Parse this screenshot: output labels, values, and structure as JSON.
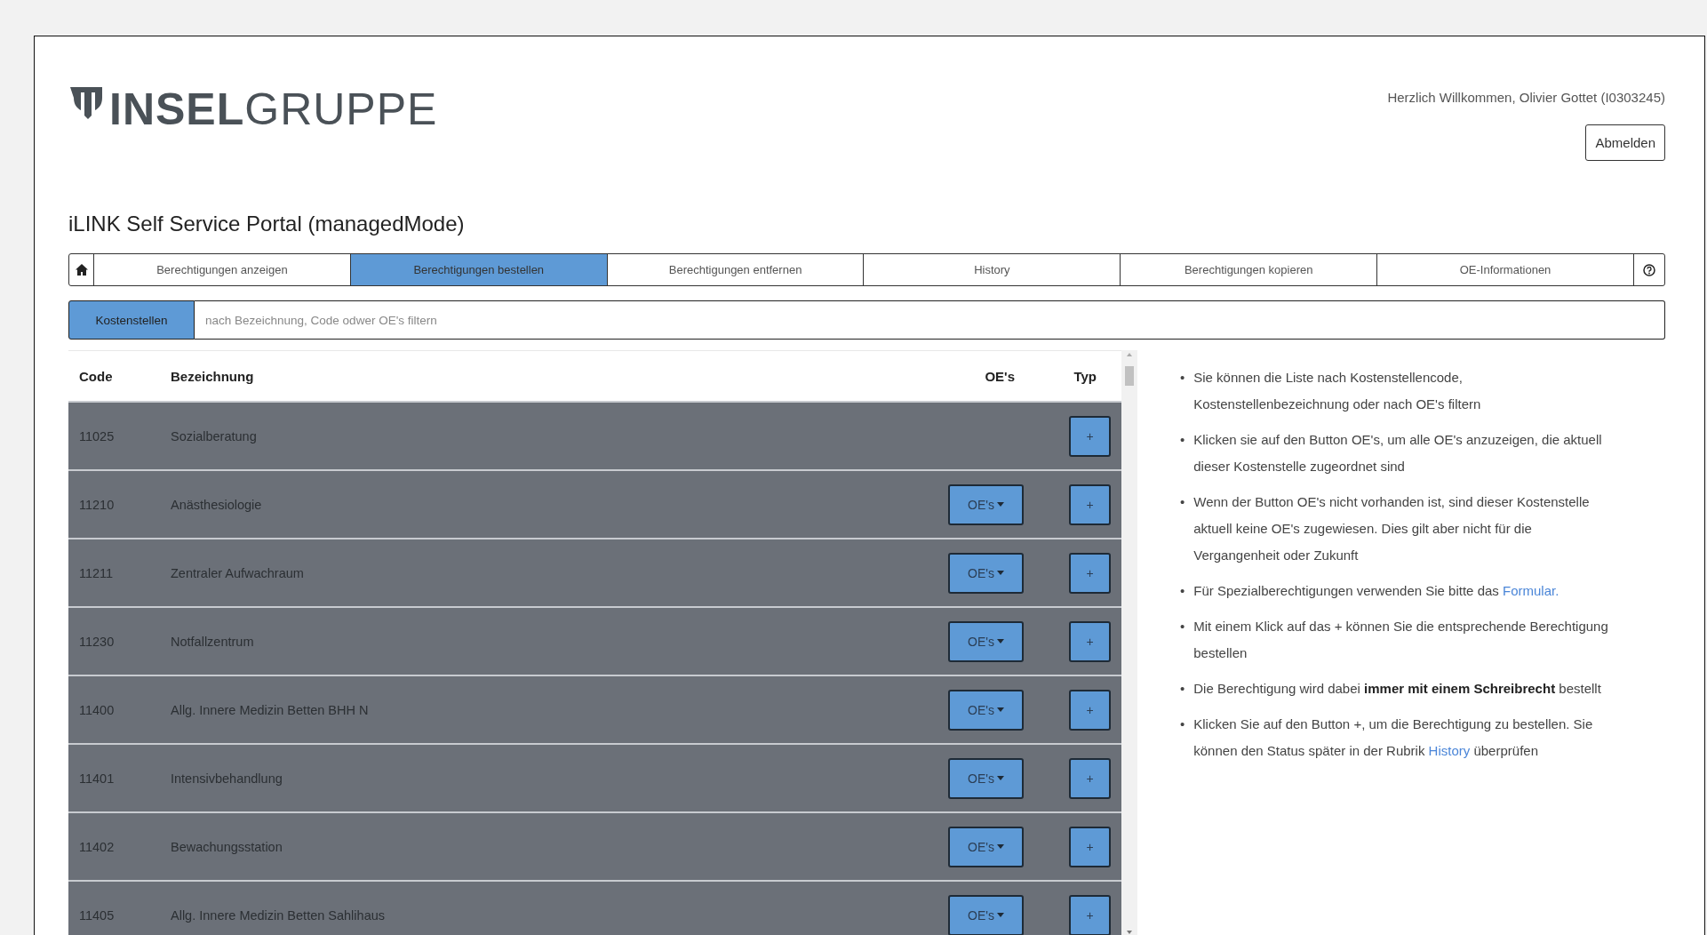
{
  "header": {
    "logo": {
      "bold": "INSEL",
      "regular": "GRUPPE"
    },
    "welcome": "Herzlich Willkommen, Olivier Gottet (I0303245)",
    "logout": "Abmelden"
  },
  "title": "iLINK Self Service Portal (managedMode)",
  "tabs": [
    {
      "label": "Berechtigungen anzeigen",
      "selected": false
    },
    {
      "label": "Berechtigungen bestellen",
      "selected": true
    },
    {
      "label": "Berechtigungen entfernen",
      "selected": false
    },
    {
      "label": "History",
      "selected": false
    },
    {
      "label": "Berechtigungen kopieren",
      "selected": false
    },
    {
      "label": "OE-Informationen",
      "selected": false
    }
  ],
  "filter": {
    "label": "Kostenstellen",
    "placeholder": "nach Bezeichnung, Code odwer OE's filtern"
  },
  "table": {
    "columns": [
      "Code",
      "Bezeichnung",
      "OE's",
      "Typ"
    ],
    "rows": [
      {
        "code": "11025",
        "name": "Sozialberatung",
        "oes_button": null,
        "add": "+"
      },
      {
        "code": "11210",
        "name": "Anästhesiologie",
        "oes_button": "OE's",
        "add": "+"
      },
      {
        "code": "11211",
        "name": "Zentraler Aufwachraum",
        "oes_button": "OE's",
        "add": "+"
      },
      {
        "code": "11230",
        "name": "Notfallzentrum",
        "oes_button": "OE's",
        "add": "+"
      },
      {
        "code": "11400",
        "name": "Allg. Innere Medizin Betten BHH N",
        "oes_button": "OE's",
        "add": "+"
      },
      {
        "code": "11401",
        "name": "Intensivbehandlung",
        "oes_button": "OE's",
        "add": "+"
      },
      {
        "code": "11402",
        "name": "Bewachungsstation",
        "oes_button": "OE's",
        "add": "+"
      },
      {
        "code": "11405",
        "name": "Allg. Innere Medizin Betten Sahlihaus",
        "oes_button": "OE's",
        "add": "+"
      }
    ]
  },
  "info": [
    {
      "bullet": "•",
      "parts": [
        {
          "kind": "text",
          "text": "Sie können die Liste nach Kostenstellencode, Kostenstellenbezeichnung oder nach OE's filtern"
        }
      ]
    },
    {
      "bullet": "•",
      "parts": [
        {
          "kind": "text",
          "text": "Klicken sie auf den Button OE's, um alle OE's anzuzeigen, die aktuell dieser Kostenstelle zugeordnet sind"
        }
      ]
    },
    {
      "bullet": "•",
      "parts": [
        {
          "kind": "text",
          "text": "Wenn der Button OE's nicht vorhanden ist, sind dieser Kostenstelle aktuell keine OE's zugewiesen. Dies gilt aber nicht für die Vergangenheit oder Zukunft"
        }
      ]
    },
    {
      "bullet": "•",
      "parts": [
        {
          "kind": "text",
          "text": "Für Spezialberechtigungen verwenden Sie bitte das "
        },
        {
          "kind": "link",
          "text": "Formular."
        }
      ]
    },
    {
      "bullet": "•",
      "parts": [
        {
          "kind": "text",
          "text": "Mit einem Klick auf das + können Sie die entsprechende Berechtigung bestellen"
        }
      ]
    },
    {
      "bullet": "•",
      "parts": [
        {
          "kind": "text",
          "text": "Die Berechtigung wird dabei **immer mit einem Schreibrecht** bestellt"
        }
      ]
    },
    {
      "bullet": "•",
      "parts": [
        {
          "kind": "text",
          "text": "Klicken Sie auf den Button +, um die Berechtigung zu bestellen. Sie können den Status später in der Rubrik "
        },
        {
          "kind": "link",
          "text": "History"
        },
        {
          "kind": "text",
          "text": " überprüfen"
        }
      ]
    }
  ]
}
